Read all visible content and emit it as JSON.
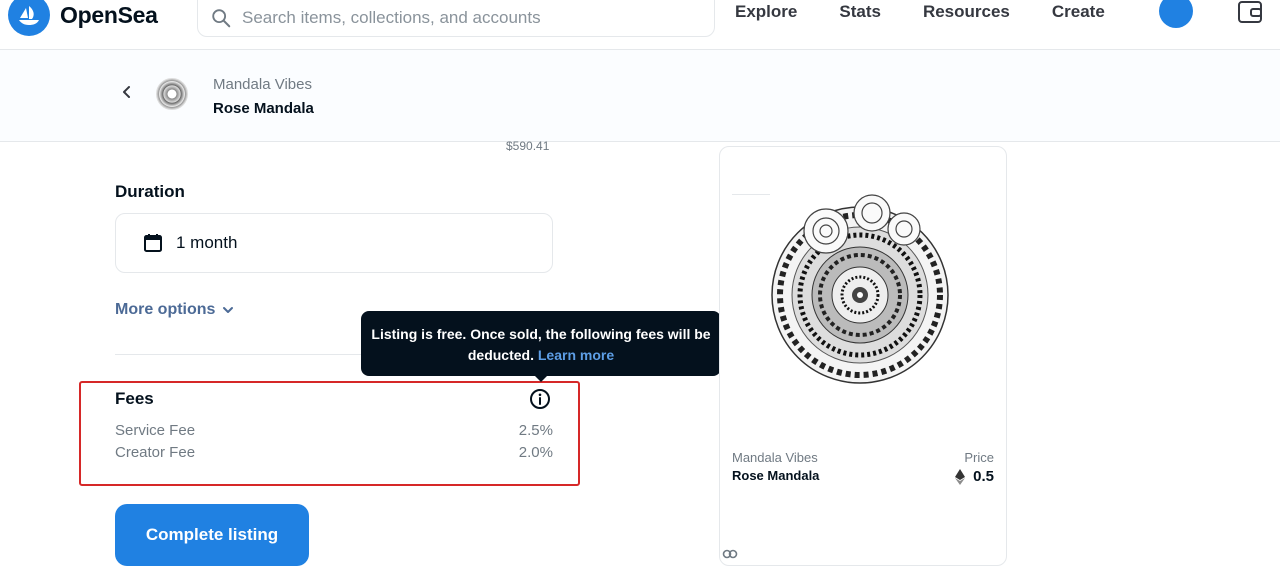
{
  "nav": {
    "brand": "OpenSea",
    "search_placeholder": "Search items, collections, and accounts",
    "links": [
      "Explore",
      "Stats",
      "Resources",
      "Create"
    ],
    "icons": [
      "opensea-logo-icon",
      "search-icon",
      "avatar-icon",
      "wallet-icon"
    ]
  },
  "header": {
    "collection": "Mandala Vibes",
    "item": "Rose Mandala"
  },
  "form": {
    "usd_amount": "$590.41",
    "duration_label": "Duration",
    "duration_value": "1 month",
    "more_options": "More options",
    "fees_title": "Fees",
    "fees": [
      {
        "label": "Service Fee",
        "value": "2.5%"
      },
      {
        "label": "Creator Fee",
        "value": "2.0%"
      }
    ],
    "tooltip_text": "Listing is free. Once sold, the following fees will be deducted.",
    "tooltip_link": "Learn more",
    "complete_button": "Complete listing"
  },
  "preview": {
    "collection": "Mandala Vibes",
    "item": "Rose Mandala",
    "price_label": "Price",
    "price": "0.5"
  },
  "colors": {
    "accent": "#2081e2",
    "highlight_border": "#d62828",
    "tooltip_bg": "#04111d",
    "link": "#5d9ee6"
  }
}
